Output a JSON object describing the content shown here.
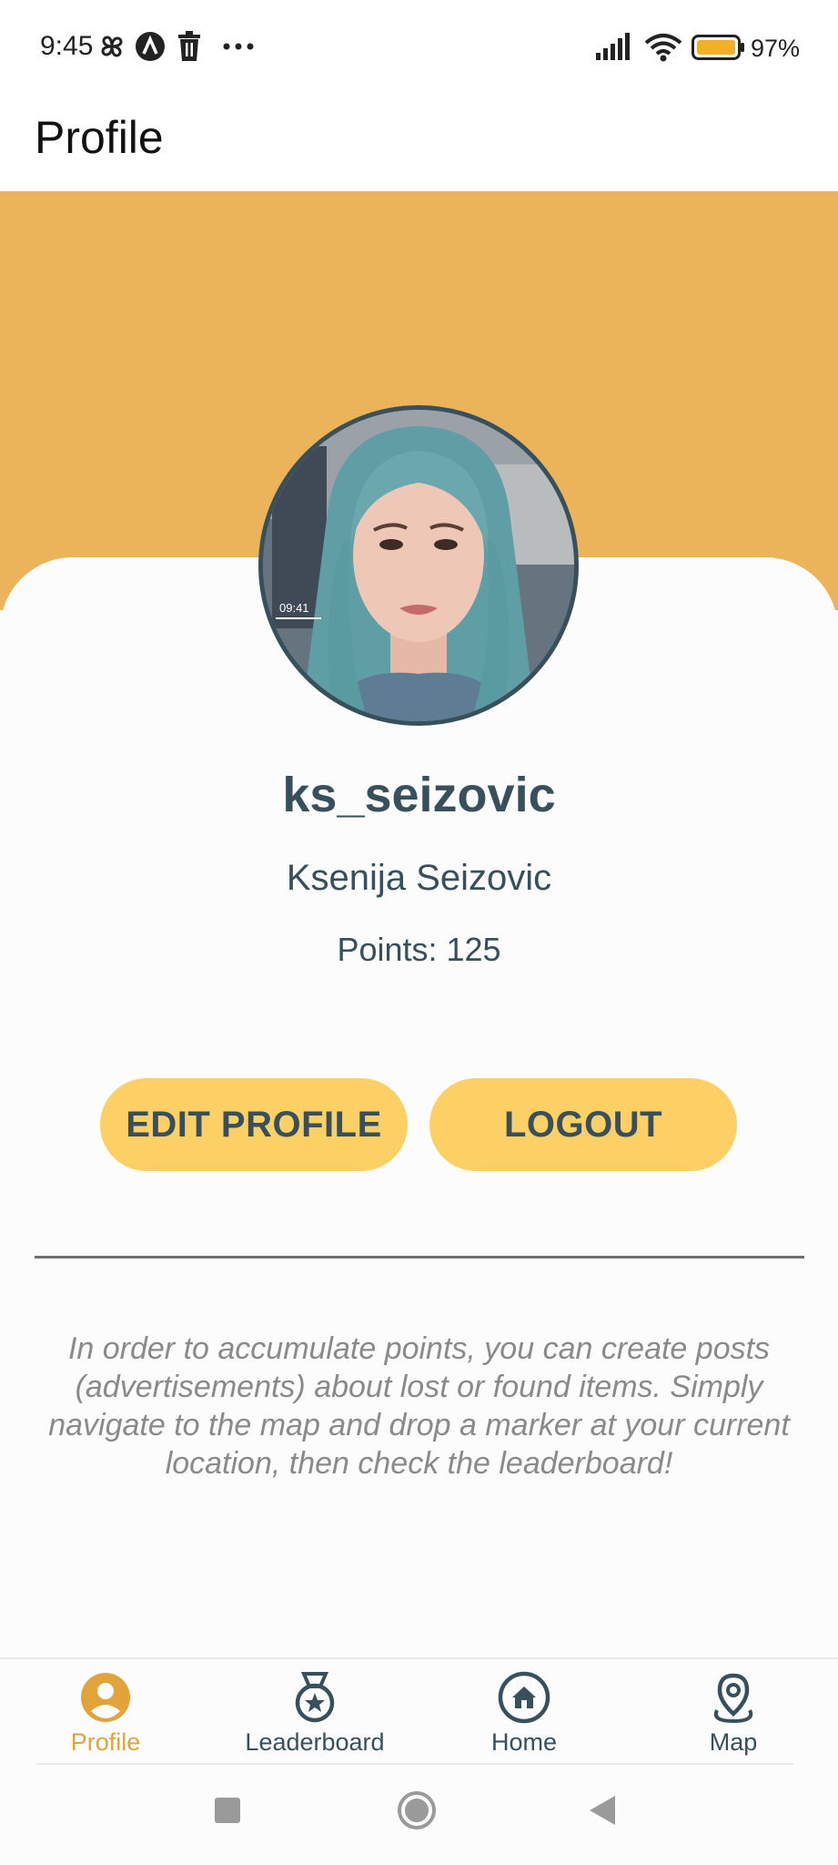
{
  "status_bar": {
    "time": "9:45",
    "battery_percent": "97%",
    "icons": [
      "pinwheel-icon",
      "a-circle-icon",
      "trash-icon",
      "more-icon",
      "signal-icon",
      "wifi-icon",
      "battery-icon"
    ]
  },
  "app_bar": {
    "title": "Profile"
  },
  "profile": {
    "username": "ks_seizovic",
    "full_name": "Ksenija Seizovic",
    "points_label": "Points: 125",
    "points": 125
  },
  "actions": {
    "edit_label": "EDIT PROFILE",
    "logout_label": "LOGOUT"
  },
  "info_text": "In order to accumulate points, you can create posts (advertisements) about lost or found items. Simply navigate to the map and drop a marker at your current location, then check the leaderboard!",
  "bottom_nav": {
    "items": [
      {
        "label": "Profile",
        "icon": "person-icon",
        "active": true
      },
      {
        "label": "Leaderboard",
        "icon": "medal-icon",
        "active": false
      },
      {
        "label": "Home",
        "icon": "home-icon",
        "active": false
      },
      {
        "label": "Map",
        "icon": "map-pin-icon",
        "active": false
      }
    ]
  },
  "colors": {
    "banner": "#ebb35a",
    "button": "#fdd066",
    "primary_text": "#37505c",
    "active_nav": "#e3a33b",
    "info_text": "#8a8a8a"
  }
}
